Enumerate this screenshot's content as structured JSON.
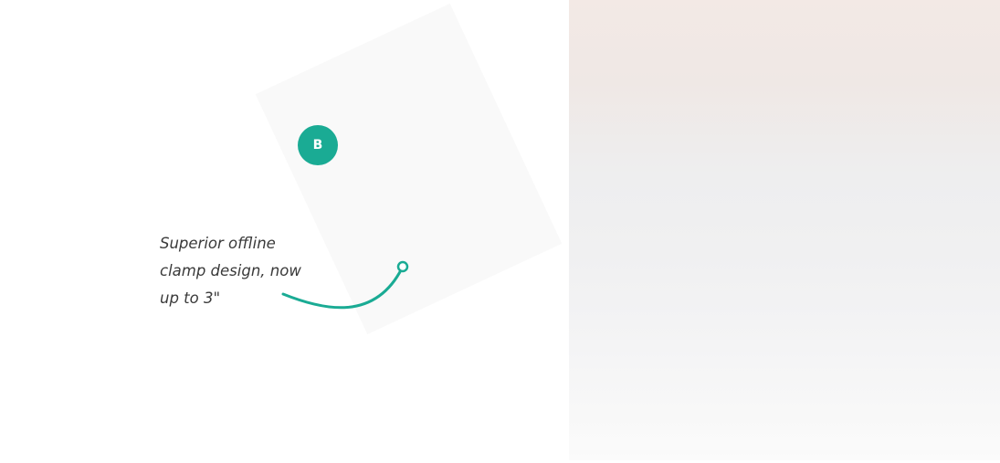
{
  "callout": {
    "badge_letter": "B",
    "caption_lines": [
      "Superior offline",
      "clamp design, now",
      "up to 3\""
    ]
  },
  "colors": {
    "accent": "#1aab94"
  },
  "photo_panel": {
    "description_icon": "product-photo"
  }
}
